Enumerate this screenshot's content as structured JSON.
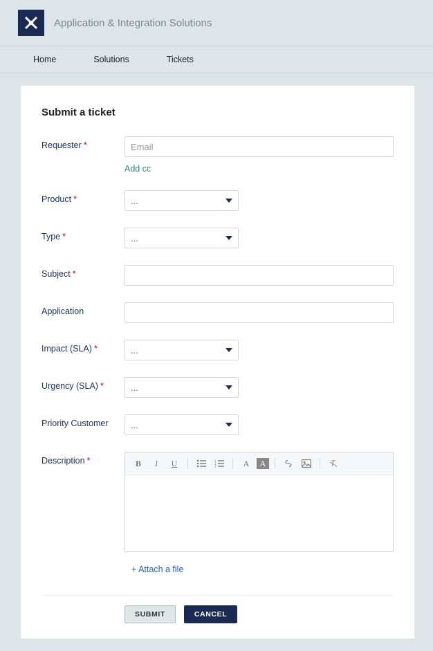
{
  "header": {
    "title": "Application & Integration Solutions"
  },
  "nav": {
    "items": [
      "Home",
      "Solutions",
      "Tickets"
    ]
  },
  "page": {
    "title": "Submit a ticket"
  },
  "form": {
    "requester": {
      "label": "Requester",
      "placeholder": "Email",
      "add_cc": "Add cc"
    },
    "product": {
      "label": "Product",
      "selected": "..."
    },
    "type": {
      "label": "Type",
      "selected": "..."
    },
    "subject": {
      "label": "Subject"
    },
    "application": {
      "label": "Application"
    },
    "impact": {
      "label": "Impact (SLA)",
      "selected": "..."
    },
    "urgency": {
      "label": "Urgency (SLA)",
      "selected": "..."
    },
    "priority": {
      "label": "Priority Customer",
      "selected": "..."
    },
    "description": {
      "label": "Description"
    },
    "attach": "+ Attach a file"
  },
  "actions": {
    "submit": "SUBMIT",
    "cancel": "CANCEL"
  }
}
